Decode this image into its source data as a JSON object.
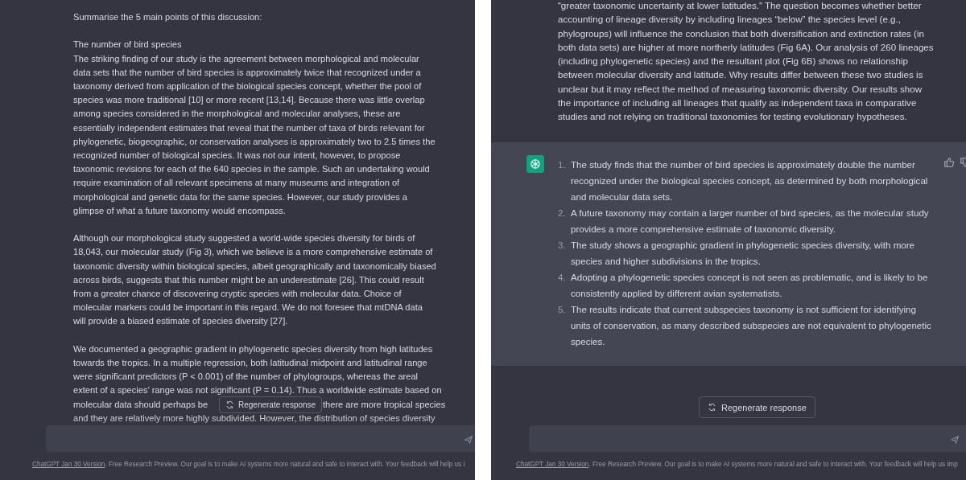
{
  "left_pane": {
    "message": {
      "paragraphs": [
        {
          "lines": [
            "Summarise the 5 main points of this discussion:"
          ]
        },
        {
          "lines": [
            "The number of bird species",
            "The striking finding of our study is the agreement between morphological and molecular",
            "data sets that the number of bird species is approximately twice that recognized under a",
            "taxonomy derived from application of the biological species concept, whether the pool of",
            "species was more traditional [10] or more recent [13,14]. Because there was little overlap",
            "among species considered in the morphological and molecular analyses, these are",
            "essentially independent estimates that reveal that the number of taxa of birds relevant for",
            "phylogenetic, biogeographic, or conservation analyses is approximately two to 2.5 times the",
            "recognized number of biological species. It was not our intent, however, to propose",
            "taxonomic revisions for each of the 640 species in the sample. Such an undertaking would",
            "require examination of all relevant specimens at many museums and integration of",
            "morphological and genetic data for the same species. However, our study provides a",
            "glimpse of what a future taxonomy would encompass."
          ]
        },
        {
          "lines": [
            "Although our morphological study suggested a world-wide species diversity for birds of",
            "18,043, our molecular study (Fig 3), which we believe is a more comprehensive estimate of",
            "taxonomic diversity within biological species, albeit geographically and taxonomically biased",
            "across birds, suggests that this number might be an underestimate [26]. This could result",
            "from a greater chance of discovering cryptic species with molecular data. Choice of",
            "molecular markers could be important in this regard. We do not foresee that mtDNA data",
            "will provide a biased estimate of species diversity [27]."
          ]
        },
        {
          "lines": [
            "We documented a geographic gradient in phylogenetic species diversity from high latitudes",
            "towards the tropics. In a multiple regression, both latitudinal midpoint and latitudinal range",
            "were significant predictors (P < 0.001) of the number of phylogroups, whereas the areal",
            "extent of a species’ range was not significant (P = 0.14). Thus a worldwide estimate based on"
          ]
        }
      ],
      "covered_lines": [
        {
          "before": "molecular data should perhaps be",
          "after": "there are more tropical species"
        },
        {
          "before": "and they are relatively more highly subdivided. However, the distribution of species diversity"
        }
      ]
    },
    "regenerate_button": "Regenerate response",
    "footer": {
      "link": "ChatGPT Jan 30 Version",
      "text": ". Free Research Preview. Our goal is to make AI systems more natural and safe to interact with. Your feedback will help us i"
    }
  },
  "right_pane": {
    "user_message": {
      "lines": [
        "“greater taxonomic uncertainty at lower latitudes.” The question becomes whether better",
        "accounting of lineage diversity by including lineages “below” the species level (e.g.,",
        "phylogroups) will influence the conclusion that both diversification and extinction rates (in",
        "both data sets) are higher at more northerly latitudes (Fig 6A). Our analysis of 260 lineages",
        "(including phylogenetic species) and the resultant plot (Fig 6B) shows no relationship",
        "between molecular diversity and latitude. Why results differ between these two studies is",
        "unclear but it may reflect the method of measuring taxonomic diversity. Our results show",
        "the importance of including all lineages that qualify as independent taxa in comparative",
        "studies and not relying on traditional taxonomies for testing evolutionary hypotheses."
      ]
    },
    "response": {
      "items": [
        {
          "number": "1.",
          "lines": [
            "The study finds that the number of bird species is approximately double the number",
            "recognized under the biological species concept, as determined by both morphological",
            "and molecular data sets."
          ]
        },
        {
          "number": "2.",
          "lines": [
            "A future taxonomy may contain a larger number of bird species, as the molecular study",
            "provides a more comprehensive estimate of taxonomic diversity."
          ]
        },
        {
          "number": "3.",
          "lines": [
            "The study shows a geographic gradient in phylogenetic species diversity, with more",
            "species and higher subdivisions in the tropics."
          ]
        },
        {
          "number": "4.",
          "lines": [
            "Adopting a phylogenetic species concept is not seen as problematic, and is likely to be",
            "consistently applied by different avian systematists."
          ]
        },
        {
          "number": "5.",
          "lines": [
            "The results indicate that current subspecies taxonomy is not sufficient for identifying",
            "units of conservation, as many described subspecies are not equivalent to phylogenetic",
            "species."
          ]
        }
      ]
    },
    "regenerate_button": "Regenerate response",
    "footer": {
      "link": "ChatGPT Jan 30 Version",
      "text": ". Free Research Preview. Our goal is to make AI systems more natural and safe to interact with. Your feedback will help us imp"
    }
  }
}
